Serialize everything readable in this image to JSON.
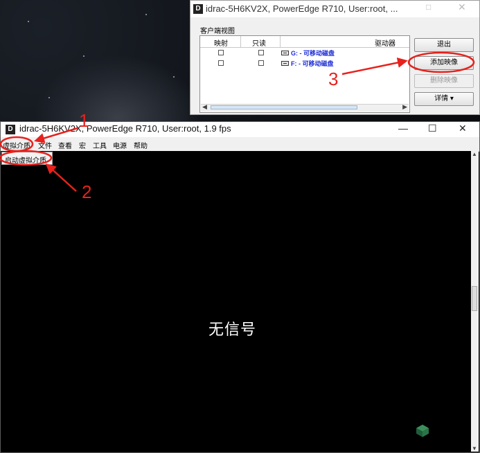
{
  "colors": {
    "annotation_red": "#e8211c",
    "drive_text_blue": "#1b2bd6",
    "console_background": "#000000"
  },
  "virtual_media_window": {
    "title": "idrac-5H6KV2X, PowerEdge R710, User:root, ...",
    "app_icon_letter": "D",
    "group_label": "客户端视图",
    "columns": [
      "映射",
      "只读",
      "驱动器"
    ],
    "rows": [
      {
        "mapped": false,
        "read_only": false,
        "drive_icon": "drive-icon",
        "drive": "G: - 可移动磁盘"
      },
      {
        "mapped": false,
        "read_only": false,
        "drive_icon": "drive-icon",
        "drive": "F: - 可移动磁盘"
      }
    ],
    "buttons": {
      "exit": "退出",
      "add_image": "添加映像",
      "remove_image": "删除映像",
      "details": "详情 ▾"
    }
  },
  "console_window": {
    "title": "idrac-5H6KV2X, PowerEdge R710, User:root, 1.9 fps",
    "app_icon_letter": "D",
    "menu": [
      "虚拟介质",
      "文件",
      "查看",
      "宏",
      "工具",
      "电源",
      "帮助"
    ],
    "dropdown_item": "启动虚拟介质",
    "screen_text": "无信号"
  },
  "annotations": [
    "1",
    "2",
    "3"
  ]
}
